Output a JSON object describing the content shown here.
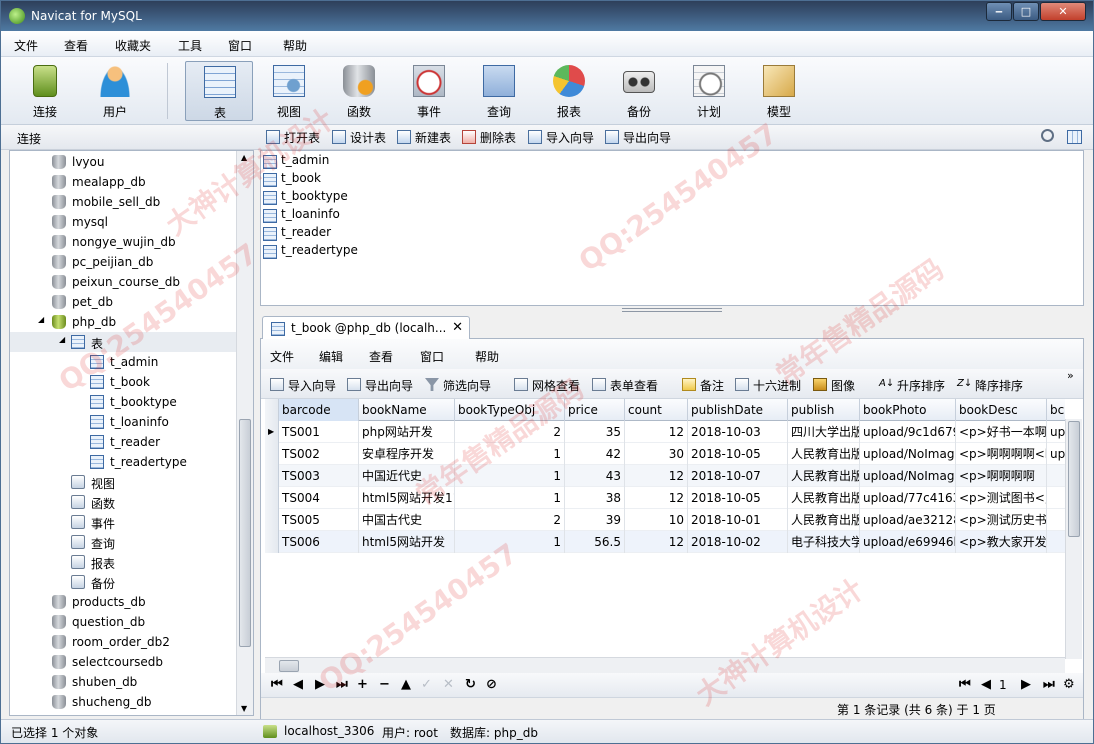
{
  "window": {
    "title": "Navicat for MySQL"
  },
  "menu": [
    "文件",
    "查看",
    "收藏夹",
    "工具",
    "窗口",
    "帮助"
  ],
  "toolbar": [
    {
      "label": "连接",
      "icon": "connection-icon"
    },
    {
      "label": "用户",
      "icon": "user-icon"
    },
    {
      "label": "表",
      "icon": "table-icon"
    },
    {
      "label": "视图",
      "icon": "view-icon"
    },
    {
      "label": "函数",
      "icon": "function-icon"
    },
    {
      "label": "事件",
      "icon": "event-icon"
    },
    {
      "label": "查询",
      "icon": "query-icon"
    },
    {
      "label": "报表",
      "icon": "report-icon"
    },
    {
      "label": "备份",
      "icon": "backup-icon"
    },
    {
      "label": "计划",
      "icon": "schedule-icon"
    },
    {
      "label": "模型",
      "icon": "model-icon"
    }
  ],
  "subbar": {
    "left_label": "连接",
    "buttons": [
      "打开表",
      "设计表",
      "新建表",
      "删除表",
      "导入向导",
      "导出向导"
    ]
  },
  "tree": {
    "dbs_top": [
      "lvyou",
      "mealapp_db",
      "mobile_sell_db",
      "mysql",
      "nongye_wujin_db",
      "pc_peijian_db",
      "peixun_course_db",
      "pet_db"
    ],
    "open_db": "php_db",
    "tables_node": "表",
    "tables": [
      "t_admin",
      "t_book",
      "t_booktype",
      "t_loaninfo",
      "t_reader",
      "t_readertype"
    ],
    "other_nodes": [
      "视图",
      "函数",
      "事件",
      "查询",
      "报表",
      "备份"
    ],
    "dbs_bottom": [
      "products_db",
      "question_db",
      "room_order_db2",
      "selectcoursedb",
      "shuben_db",
      "shucheng_db"
    ]
  },
  "objects": [
    "t_admin",
    "t_book",
    "t_booktype",
    "t_loaninfo",
    "t_reader",
    "t_readertype"
  ],
  "tab": {
    "label": "t_book @php_db (localh...",
    "close": "✕"
  },
  "panel_menu": [
    "文件",
    "编辑",
    "查看",
    "窗口",
    "帮助"
  ],
  "panel_tools": [
    "导入向导",
    "导出向导",
    "筛选向导",
    "网格查看",
    "表单查看",
    "备注",
    "十六进制",
    "图像",
    "升序排序",
    "降序排序"
  ],
  "grid": {
    "columns": [
      "barcode",
      "bookName",
      "bookTypeObj",
      "price",
      "count",
      "publishDate",
      "publish",
      "bookPhoto",
      "bookDesc",
      "bc"
    ],
    "rows": [
      [
        "TS001",
        "php网站开发",
        "2",
        "35",
        "12",
        "2018-10-03",
        "四川大学出版",
        "upload/9c1d679",
        "<p>好书一本啊",
        "up"
      ],
      [
        "TS002",
        "安卓程序开发",
        "1",
        "42",
        "30",
        "2018-10-05",
        "人民教育出版",
        "upload/NoImag",
        "<p>啊啊啊啊<l",
        "up"
      ],
      [
        "TS003",
        "中国近代史",
        "1",
        "43",
        "12",
        "2018-10-07",
        "人民教育出版",
        "upload/NoImag",
        "<p>啊啊啊啊",
        ""
      ],
      [
        "TS004",
        "html5网站开发11",
        "1",
        "38",
        "12",
        "2018-10-05",
        "人民教育出版",
        "upload/77c4163",
        "<p>测试图书<,",
        ""
      ],
      [
        "TS005",
        "中国古代史",
        "2",
        "39",
        "10",
        "2018-10-01",
        "人民教育出版",
        "upload/ae32128",
        "<p>测试历史书",
        ""
      ],
      [
        "TS006",
        "html5网站开发",
        "1",
        "56.5",
        "12",
        "2018-10-02",
        "电子科技大学",
        "upload/e69946l",
        "<p>教大家开发",
        ""
      ]
    ]
  },
  "navbar": {
    "page": "1"
  },
  "record_status": "第 1 条记录 (共 6 条) 于 1 页",
  "status": {
    "selection": "已选择 1 个对象",
    "connection": "localhost_3306",
    "user": "用户: root",
    "database": "数据库: php_db"
  },
  "watermarks": [
    "QQ:254540457",
    "大神计算机设计",
    "常年售精品源码"
  ]
}
